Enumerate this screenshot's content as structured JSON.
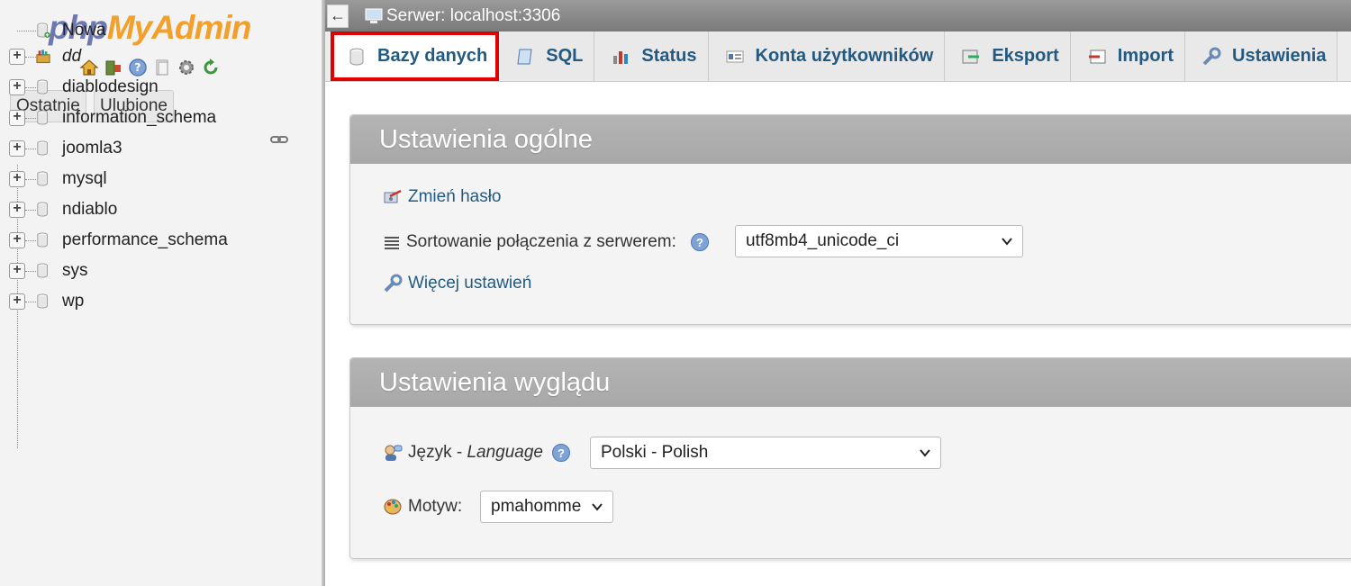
{
  "sidebar": {
    "logo": {
      "part1": "php",
      "part2": "MyAdmin"
    },
    "quick_icons": [
      "home-icon",
      "logout-icon",
      "help-icon",
      "docs-icon",
      "settings-icon",
      "reload-icon"
    ],
    "buttons": {
      "recent": "Ostatnie",
      "favorites": "Ulubione"
    },
    "tree": [
      {
        "label": "Nowa",
        "type": "new"
      },
      {
        "label": "dd",
        "type": "group"
      },
      {
        "label": "diablodesign",
        "type": "db"
      },
      {
        "label": "information_schema",
        "type": "db"
      },
      {
        "label": "joomla3",
        "type": "db"
      },
      {
        "label": "mysql",
        "type": "db"
      },
      {
        "label": "ndiablo",
        "type": "db"
      },
      {
        "label": "performance_schema",
        "type": "db"
      },
      {
        "label": "sys",
        "type": "db"
      },
      {
        "label": "wp",
        "type": "db"
      }
    ]
  },
  "topbar": {
    "back": "←",
    "server": "Serwer: localhost:3306"
  },
  "tabs": [
    {
      "label": "Bazy danych",
      "icon": "database-icon",
      "active": true
    },
    {
      "label": "SQL",
      "icon": "sql-icon",
      "active": false
    },
    {
      "label": "Status",
      "icon": "status-icon",
      "active": false
    },
    {
      "label": "Konta użytkowników",
      "icon": "users-icon",
      "active": false
    },
    {
      "label": "Eksport",
      "icon": "export-icon",
      "active": false
    },
    {
      "label": "Import",
      "icon": "import-icon",
      "active": false
    },
    {
      "label": "Ustawienia",
      "icon": "wrench-icon",
      "active": false
    }
  ],
  "general": {
    "title": "Ustawienia ogólne",
    "change_password": "Zmień hasło",
    "collation_label": "Sortowanie połączenia z serwerem:",
    "collation_value": "utf8mb4_unicode_ci",
    "more_settings": "Więcej ustawień"
  },
  "appearance": {
    "title": "Ustawienia wyglądu",
    "language_label_pl": "Język - ",
    "language_label_en": "Language",
    "language_value": "Polski - Polish",
    "theme_label": "Motyw:",
    "theme_value": "pmahomme"
  },
  "colors": {
    "accent_link": "#235a81",
    "highlight": "#e00000",
    "logo_blue": "#6c78af",
    "logo_orange": "#f29f2b"
  }
}
